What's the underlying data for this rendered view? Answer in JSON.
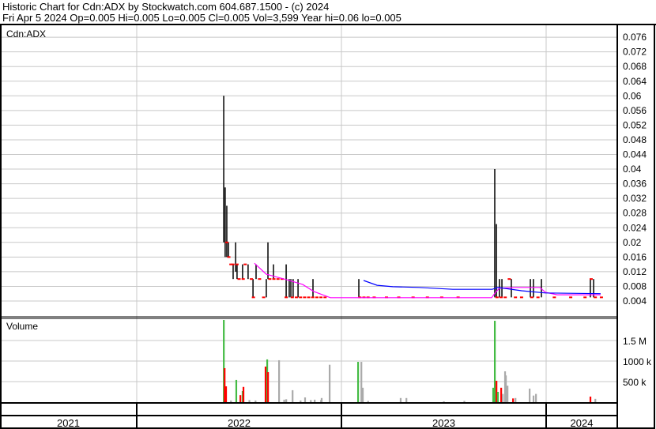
{
  "header": {
    "title": "Historic Chart for Cdn:ADX by Stockwatch.com 604.687.1500 - (c) 2024",
    "quote": "Fri Apr  5 2024  Op=0.005  Hi=0.005  Lo=0.005  Cl=0.005  Vol=3,599  Year hi=0.06  lo=0.005"
  },
  "colors": {
    "up": "#44bb44",
    "down": "#ff0000",
    "flat": "#aaaaaa",
    "ma_short": "#ff00ff",
    "ma_long": "#0000ff",
    "grid": "#c8c8c8"
  },
  "chart_data": [
    {
      "type": "line",
      "title": "Cdn:ADX",
      "ylim": [
        0,
        0.078
      ],
      "y_ticks": [
        "0.076",
        "0.072",
        "0.068",
        "0.064",
        "0.06",
        "0.056",
        "0.052",
        "0.048",
        "0.044",
        "0.04",
        "0.036",
        "0.032",
        "0.028",
        "0.024",
        "0.02",
        "0.016",
        "0.012",
        "0.008",
        "0.004"
      ],
      "xlim": [
        2021.33,
        2024.35
      ],
      "x_ticks": [
        "2021",
        "2022",
        "2023",
        "2024"
      ],
      "grid": true,
      "price_bars": [
        [
          2022.425,
          0.06,
          0.02
        ],
        [
          2022.432,
          0.035,
          0.016
        ],
        [
          2022.44,
          0.03,
          0.016
        ],
        [
          2022.448,
          0.02,
          0.016
        ],
        [
          2022.471,
          0.014,
          0.01
        ],
        [
          2022.483,
          0.02,
          0.012
        ],
        [
          2022.49,
          0.014,
          0.01
        ],
        [
          2022.517,
          0.014,
          0.01
        ],
        [
          2022.544,
          0.014,
          0.01
        ],
        [
          2022.568,
          0.01,
          0.005
        ],
        [
          2022.583,
          0.014,
          0.01
        ],
        [
          2022.633,
          0.01,
          0.005
        ],
        [
          2022.641,
          0.02,
          0.01
        ],
        [
          2022.668,
          0.014,
          0.01
        ],
        [
          2022.73,
          0.014,
          0.005
        ],
        [
          2022.745,
          0.01,
          0.005
        ],
        [
          2022.753,
          0.01,
          0.005
        ],
        [
          2022.764,
          0.01,
          0.005
        ],
        [
          2022.788,
          0.01,
          0.005
        ],
        [
          2022.861,
          0.01,
          0.005
        ],
        [
          2023.085,
          0.01,
          0.005
        ],
        [
          2023.749,
          0.04,
          0.005
        ],
        [
          2023.757,
          0.025,
          0.005
        ],
        [
          2023.772,
          0.01,
          0.005
        ],
        [
          2023.784,
          0.01,
          0.005
        ],
        [
          2023.83,
          0.01,
          0.005
        ],
        [
          2023.923,
          0.01,
          0.005
        ],
        [
          2023.938,
          0.01,
          0.005
        ],
        [
          2023.977,
          0.01,
          0.005
        ],
        [
          2024.216,
          0.01,
          0.005
        ],
        [
          2024.232,
          0.01,
          0.005
        ]
      ],
      "close_ticks": [
        [
          2022.44,
          0.02
        ],
        [
          2022.45,
          0.016
        ],
        [
          2022.46,
          0.014
        ],
        [
          2022.47,
          0.014
        ],
        [
          2022.49,
          0.014
        ],
        [
          2022.5,
          0.01
        ],
        [
          2022.52,
          0.01
        ],
        [
          2022.53,
          0.014
        ],
        [
          2022.56,
          0.01
        ],
        [
          2022.57,
          0.005
        ],
        [
          2022.6,
          0.01
        ],
        [
          2022.62,
          0.005
        ],
        [
          2022.65,
          0.01
        ],
        [
          2022.67,
          0.01
        ],
        [
          2022.69,
          0.01
        ],
        [
          2022.71,
          0.01
        ],
        [
          2022.73,
          0.005
        ],
        [
          2022.76,
          0.005
        ],
        [
          2022.78,
          0.005
        ],
        [
          2022.8,
          0.005
        ],
        [
          2022.82,
          0.005
        ],
        [
          2022.84,
          0.005
        ],
        [
          2022.86,
          0.005
        ],
        [
          2022.88,
          0.005
        ],
        [
          2022.9,
          0.005
        ],
        [
          2022.92,
          0.005
        ],
        [
          2023.09,
          0.005
        ],
        [
          2023.11,
          0.005
        ],
        [
          2023.13,
          0.005
        ],
        [
          2023.16,
          0.005
        ],
        [
          2023.22,
          0.005
        ],
        [
          2023.28,
          0.005
        ],
        [
          2023.35,
          0.005
        ],
        [
          2023.42,
          0.005
        ],
        [
          2023.49,
          0.005
        ],
        [
          2023.57,
          0.005
        ],
        [
          2023.76,
          0.005
        ],
        [
          2023.78,
          0.005
        ],
        [
          2023.8,
          0.005
        ],
        [
          2023.82,
          0.01
        ],
        [
          2023.85,
          0.005
        ],
        [
          2023.88,
          0.005
        ],
        [
          2023.93,
          0.005
        ],
        [
          2023.96,
          0.005
        ],
        [
          2024.04,
          0.005
        ],
        [
          2024.12,
          0.005
        ],
        [
          2024.19,
          0.005
        ],
        [
          2024.22,
          0.01
        ],
        [
          2024.24,
          0.005
        ],
        [
          2024.27,
          0.005
        ]
      ],
      "series": [
        {
          "name": "MA short",
          "points": [
            [
              2022.575,
              0.0143
            ],
            [
              2022.633,
              0.0113
            ],
            [
              2022.733,
              0.0098
            ],
            [
              2022.811,
              0.0085
            ],
            [
              2022.865,
              0.0066
            ],
            [
              2022.946,
              0.0049
            ],
            [
              2023.734,
              0.0049
            ],
            [
              2023.753,
              0.0064
            ],
            [
              2023.772,
              0.0075
            ],
            [
              2023.853,
              0.0077
            ],
            [
              2023.969,
              0.0077
            ],
            [
              2023.996,
              0.0064
            ],
            [
              2024.054,
              0.0057
            ],
            [
              2024.266,
              0.0057
            ]
          ]
        },
        {
          "name": "MA long",
          "points": [
            [
              2023.108,
              0.0096
            ],
            [
              2023.174,
              0.0083
            ],
            [
              2023.251,
              0.0079
            ],
            [
              2023.378,
              0.0077
            ],
            [
              2023.544,
              0.0072
            ],
            [
              2023.737,
              0.0072
            ],
            [
              2023.764,
              0.0077
            ],
            [
              2023.88,
              0.0068
            ],
            [
              2023.996,
              0.0062
            ],
            [
              2024.266,
              0.006
            ]
          ]
        }
      ]
    },
    {
      "type": "bar",
      "title": "Volume",
      "ylim": [
        0,
        2100
      ],
      "y_unit": "k",
      "y_ticks": [
        "1.5 M",
        "1000 k",
        "500 k"
      ],
      "bars": [
        [
          2022.425,
          2000,
          "up"
        ],
        [
          2022.429,
          827,
          "down"
        ],
        [
          2022.432,
          350,
          "down"
        ],
        [
          2022.436,
          385,
          "down"
        ],
        [
          2022.46,
          40,
          "flat"
        ],
        [
          2022.486,
          540,
          "up"
        ],
        [
          2022.506,
          170,
          "down"
        ],
        [
          2022.517,
          270,
          "up"
        ],
        [
          2022.521,
          370,
          "down"
        ],
        [
          2022.55,
          50,
          "flat"
        ],
        [
          2022.58,
          40,
          "flat"
        ],
        [
          2022.629,
          865,
          "down"
        ],
        [
          2022.637,
          1040,
          "up"
        ],
        [
          2022.641,
          730,
          "down"
        ],
        [
          2022.695,
          1020,
          "flat"
        ],
        [
          2022.72,
          60,
          "flat"
        ],
        [
          2022.73,
          70,
          "flat"
        ],
        [
          2022.761,
          290,
          "flat"
        ],
        [
          2022.8,
          40,
          "flat"
        ],
        [
          2022.822,
          115,
          "flat"
        ],
        [
          2022.85,
          50,
          "flat"
        ],
        [
          2022.869,
          60,
          "flat"
        ],
        [
          2022.9,
          50,
          "flat"
        ],
        [
          2022.903,
          100,
          "flat"
        ],
        [
          2022.942,
          910,
          "flat"
        ],
        [
          2023.081,
          980,
          "up"
        ],
        [
          2023.097,
          980,
          "flat"
        ],
        [
          2023.104,
          350,
          "flat"
        ],
        [
          2023.13,
          30,
          "flat"
        ],
        [
          2023.289,
          100,
          "flat"
        ],
        [
          2023.317,
          100,
          "flat"
        ],
        [
          2023.5,
          20,
          "flat"
        ],
        [
          2023.6,
          30,
          "flat"
        ],
        [
          2023.741,
          350,
          "up"
        ],
        [
          2023.749,
          1980,
          "up"
        ],
        [
          2023.757,
          520,
          "down"
        ],
        [
          2023.764,
          250,
          "up"
        ],
        [
          2023.78,
          350,
          "down"
        ],
        [
          2023.788,
          200,
          "flat"
        ],
        [
          2023.799,
          750,
          "flat"
        ],
        [
          2023.803,
          650,
          "flat"
        ],
        [
          2023.811,
          400,
          "flat"
        ],
        [
          2023.838,
          90,
          "down"
        ],
        [
          2023.85,
          100,
          "flat"
        ],
        [
          2023.919,
          330,
          "flat"
        ],
        [
          2023.938,
          160,
          "flat"
        ],
        [
          2023.95,
          200,
          "flat"
        ],
        [
          2024.216,
          135,
          "down"
        ],
        [
          2024.24,
          80,
          "flat"
        ]
      ]
    }
  ]
}
